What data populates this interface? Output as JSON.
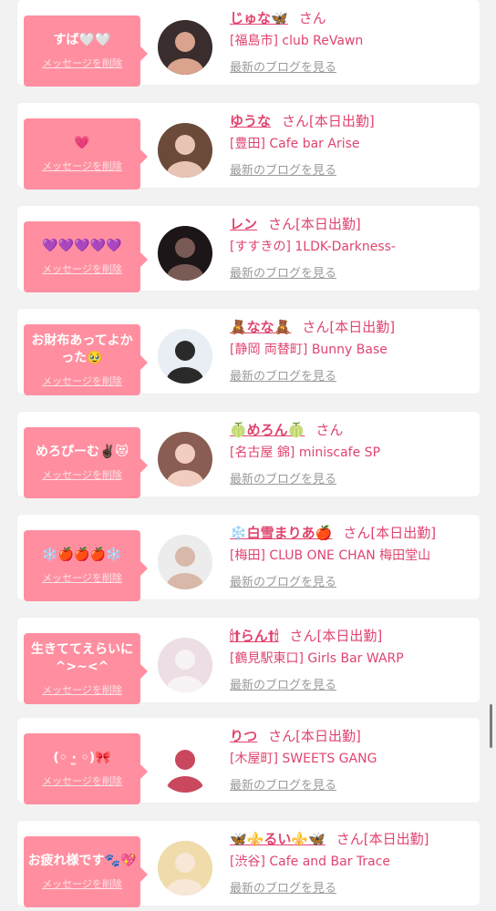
{
  "common": {
    "delete_label": "メッセージを削除",
    "blog_label": "最新のブログを見る",
    "san": "さん"
  },
  "colors": {
    "bubble": "#ff8fa0",
    "accent": "#e0446e",
    "muted": "#9a9a9a",
    "background": "#f2f2f2"
  },
  "messages": [
    {
      "text": "すば🤍🤍",
      "name": "じゅな🦋",
      "shift": "",
      "shop": "[福島市] club ReVawn",
      "avatar": {
        "bg": "#3a2d2e",
        "fg": "#d9a38d",
        "icon": "avatar-photo-icon"
      }
    },
    {
      "text": "💗",
      "name": "ゆうな",
      "shift": "[本日出勤]",
      "shop": "[豊田] Cafe bar Arise",
      "avatar": {
        "bg": "#6b4a3a",
        "fg": "#e7c4b4",
        "icon": "avatar-photo-icon"
      }
    },
    {
      "text": "💜💜💜💜💜",
      "name": "レン",
      "shift": "[本日出勤]",
      "shop": "[すすきの] 1LDK-Darkness-",
      "avatar": {
        "bg": "#1c1618",
        "fg": "#7a5a55",
        "icon": "avatar-photo-icon"
      }
    },
    {
      "text": "お財布あってよかった🥹",
      "name": "🧸なな🧸",
      "shift": "[本日出勤]",
      "shop": "[静岡 両替町] Bunny Base",
      "avatar": {
        "bg": "#e9eef5",
        "fg": "#2a2a2a",
        "icon": "avatar-photo-icon"
      }
    },
    {
      "text": "めろぴーむ✌🏿😻",
      "name": "🍈めろん🍈",
      "shift": "",
      "shop": "[名古屋 錦] miniscafe SP",
      "avatar": {
        "bg": "#8a5d52",
        "fg": "#f1cdbf",
        "icon": "avatar-photo-icon"
      }
    },
    {
      "text": "❄️🍎🍎🍎❄️",
      "name": "❄️白雪まりあ🍎",
      "shift": "[本日出勤]",
      "shop": "[梅田] CLUB ONE CHAN 梅田堂山",
      "avatar": {
        "bg": "#ececec",
        "fg": "#d8b8a8",
        "icon": "avatar-photo-icon"
      }
    },
    {
      "text": "生きててえらいに ^>~<^",
      "name": "🕯†らん†🕯",
      "shift": "[本日出勤]",
      "shop": "[鶴見駅東口] Girls Bar WARP",
      "avatar": {
        "bg": "#eddde4",
        "fg": "#f7f2f4",
        "icon": "avatar-photo-icon"
      }
    },
    {
      "text": "(◦ ·̫ ◦)🎀",
      "name": "りつ",
      "shift": "[本日出勤]",
      "shop": "[木屋町] SWEETS GANG",
      "avatar": {
        "bg": "#ffffff",
        "fg": "#c9485e",
        "icon": "avatar-photo-icon"
      }
    },
    {
      "text": "お疲れ様です🐾💖",
      "name": "🦋⚜️るい⚜️🦋",
      "shift": "[本日出勤]",
      "shop": "[渋谷] Cafe and Bar Trace",
      "avatar": {
        "bg": "#f0dcaa",
        "fg": "#f7e7d6",
        "icon": "avatar-photo-icon"
      }
    }
  ]
}
